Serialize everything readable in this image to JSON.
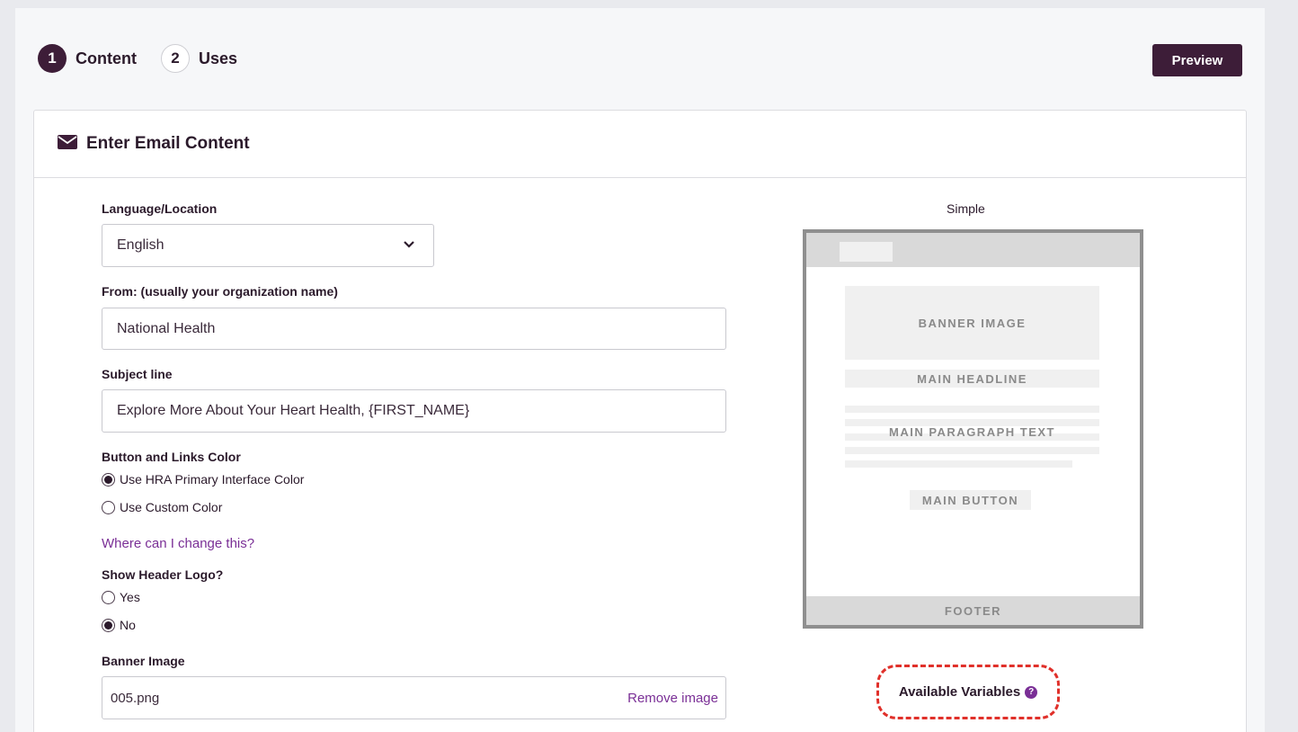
{
  "steps": [
    {
      "number": "1",
      "label": "Content",
      "active": true
    },
    {
      "number": "2",
      "label": "Uses",
      "active": false
    }
  ],
  "header": {
    "preview_label": "Preview"
  },
  "card": {
    "title": "Enter Email Content",
    "icon": "envelope-icon"
  },
  "form": {
    "language": {
      "label": "Language/Location",
      "value": "English"
    },
    "from": {
      "label": "From: (usually your organization name)",
      "value": "National Health"
    },
    "subject": {
      "label": "Subject line",
      "value": "Explore More About Your Heart Health, {FIRST_NAME}"
    },
    "color": {
      "label": "Button and Links Color",
      "options": [
        "Use HRA Primary Interface Color",
        "Use Custom Color"
      ],
      "selected": "Use HRA Primary Interface Color",
      "help_link": "Where can I change this?"
    },
    "header_logo": {
      "label": "Show Header Logo?",
      "options": [
        "Yes",
        "No"
      ],
      "selected": "No"
    },
    "banner": {
      "label": "Banner Image",
      "value": "005.png",
      "remove_label": "Remove image"
    }
  },
  "template": {
    "name": "Simple",
    "banner_image": "BANNER IMAGE",
    "main_headline": "MAIN HEADLINE",
    "main_paragraph": "MAIN PARAGRAPH TEXT",
    "main_button": "MAIN BUTTON",
    "footer": "FOOTER"
  },
  "variables": {
    "label": "Available Variables",
    "help_icon": "?"
  },
  "colors": {
    "brand": "#3d1d38",
    "link": "#7a2f96",
    "highlight": "#e0302a"
  }
}
